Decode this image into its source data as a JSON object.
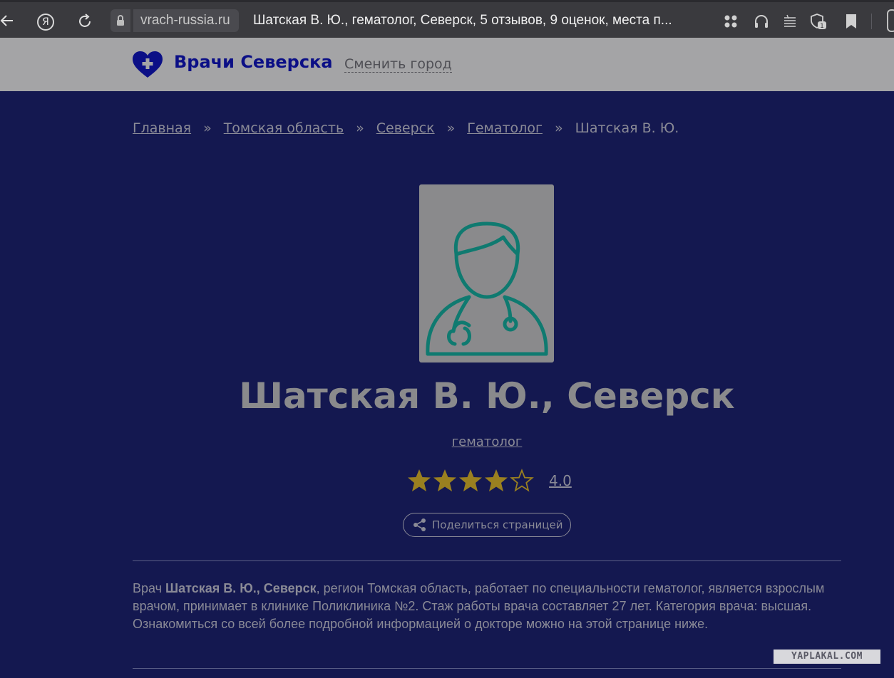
{
  "browser": {
    "url": "vrach-russia.ru",
    "tab_title": "Шатская В. Ю., гематолог, Северск, 5 отзывов, 9 оценок, места п...",
    "yandex_letter": "Я",
    "shield_badge": "1"
  },
  "header": {
    "site_name": "Врачи Северска",
    "change_city": "Сменить город"
  },
  "breadcrumb": {
    "items": [
      "Главная",
      "Томская область",
      "Северск",
      "Гематолог"
    ],
    "separator": "»",
    "current": "Шатская В. Ю."
  },
  "doctor": {
    "name": "Шатская В. Ю., Северск",
    "specialty": "гематолог",
    "rating": 4.0,
    "rating_label": "4.0",
    "rating_max": 5
  },
  "share": {
    "label": "Поделиться страницей"
  },
  "description": {
    "prefix": "Врач",
    "name_bold": "Шатская В. Ю., Северск",
    "text": ", регион Томская область, работает по специальности гематолог, является взрослым врачом, принимает в клинике Поликлиника №2. Стаж работы врача составляет 27 лет. Категория врача: высшая. Ознакомиться со всей более подробной информацией о докторе можно на этой странице ниже."
  },
  "watermark": "YAPLAKAL.COM",
  "colors": {
    "page_bg": "#141850",
    "header_bg": "#a4a4a6",
    "brand": "#0b0f86",
    "avatar_line": "#0f7a70",
    "star": "#9a8020",
    "muted_text": "#8a8a96"
  }
}
